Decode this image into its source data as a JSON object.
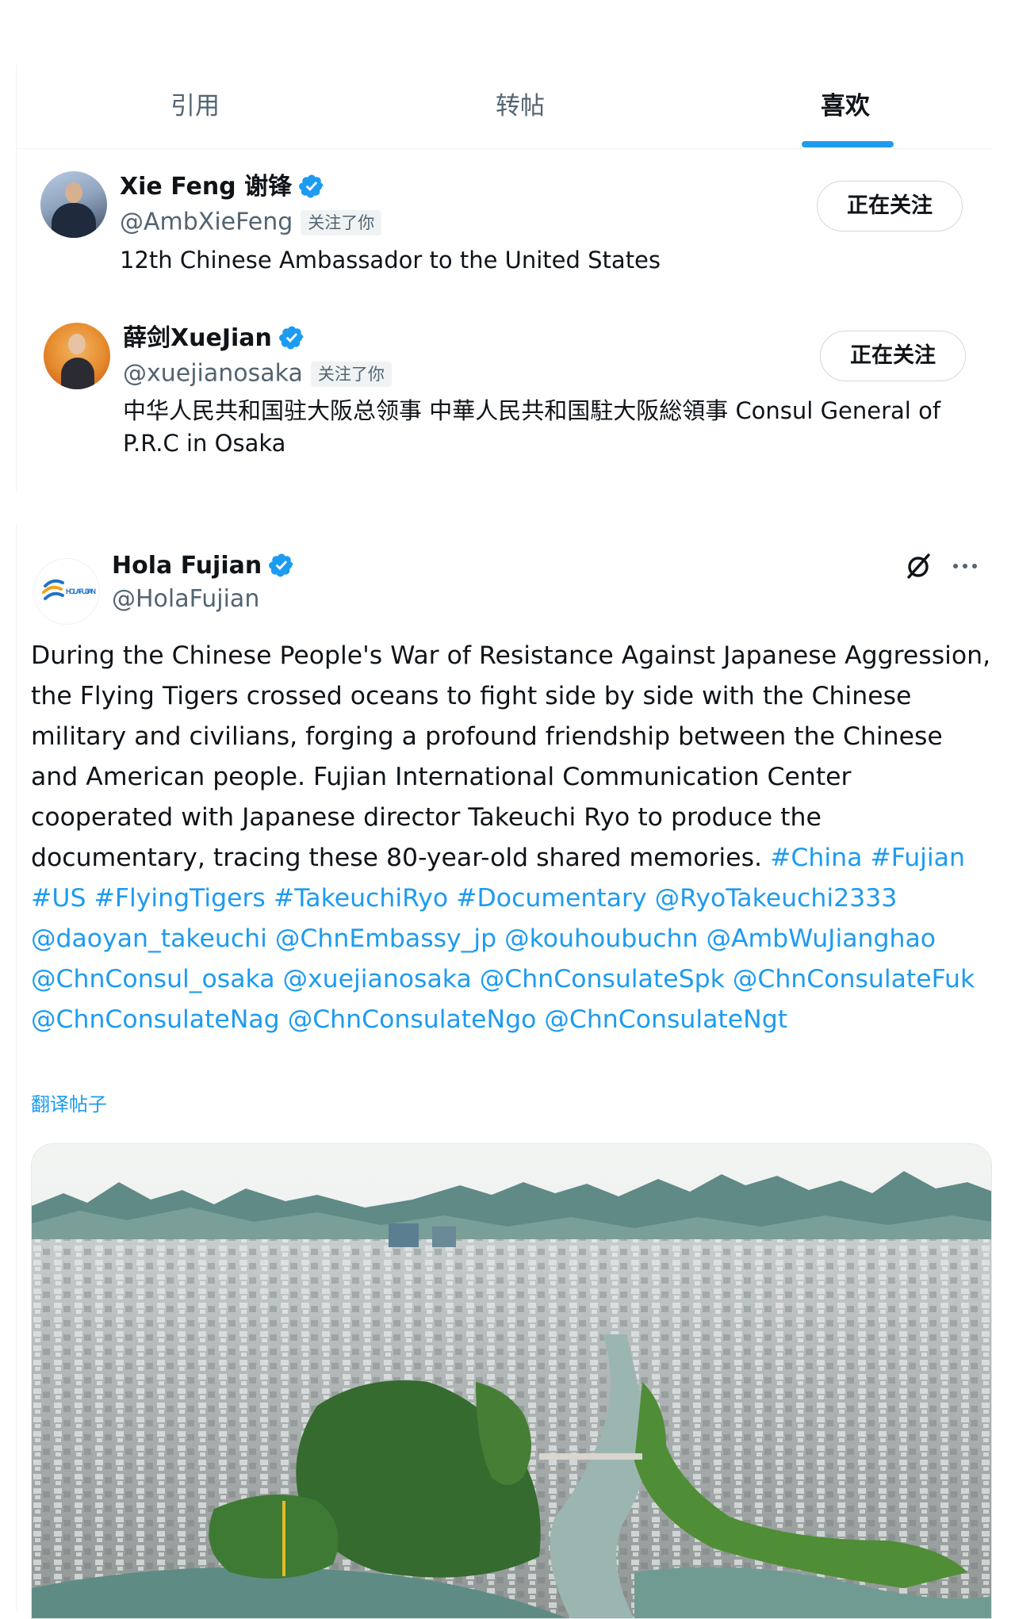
{
  "tabs": [
    {
      "label": "引用"
    },
    {
      "label": "转帖"
    },
    {
      "label": "喜欢"
    }
  ],
  "users": [
    {
      "name": "Xie Feng 谢锋",
      "handle": "@AmbXieFeng",
      "follows_you": "关注了你",
      "bio": "12th Chinese Ambassador to the United States",
      "follow_button": "正在关注"
    },
    {
      "name": "薛剑XueJian",
      "handle": "@xuejianosaka",
      "follows_you": "关注了你",
      "bio": "中华人民共和国驻大阪总领事 中華人民共和国駐大阪総領事 Consul General of P.R.C in Osaka",
      "follow_button": "正在关注"
    }
  ],
  "tweet": {
    "author": "Hola Fujian",
    "handle": "@HolaFujian",
    "logo_text": "HOLA FUJIAN",
    "text": "During the Chinese People's War of Resistance Against Japanese Aggression, the Flying Tigers crossed oceans to fight side by side with the Chinese military and civilians, forging a profound friendship between the Chinese and American people. Fujian International Communication Center cooperated with Japanese director Takeuchi Ryo to produce the documentary, tracing these 80-year-old shared memories.",
    "hashtags": "#China #Fujian #US #FlyingTigers #TakeuchiRyo #Documentary",
    "mentions": "@RyoTakeuchi2333 @daoyan_takeuchi @ChnEmbassy_jp @kouhoubuchn @AmbWuJianghao @ChnConsul_osaka @xuejianosaka @ChnConsulateSpk @ChnConsulateFuk @ChnConsulateNag @ChnConsulateNgo @ChnConsulateNgt",
    "translate": "翻译帖子",
    "media_alt": "aerial city view with karst mountains and river"
  },
  "colors": {
    "accent": "#1d9bf0",
    "text": "#0f1419",
    "secondary": "#536471",
    "verified": "#1d9bf0"
  },
  "icons": {
    "verified": "verified-badge-icon",
    "grok": "grok-icon",
    "more": "more-icon"
  }
}
